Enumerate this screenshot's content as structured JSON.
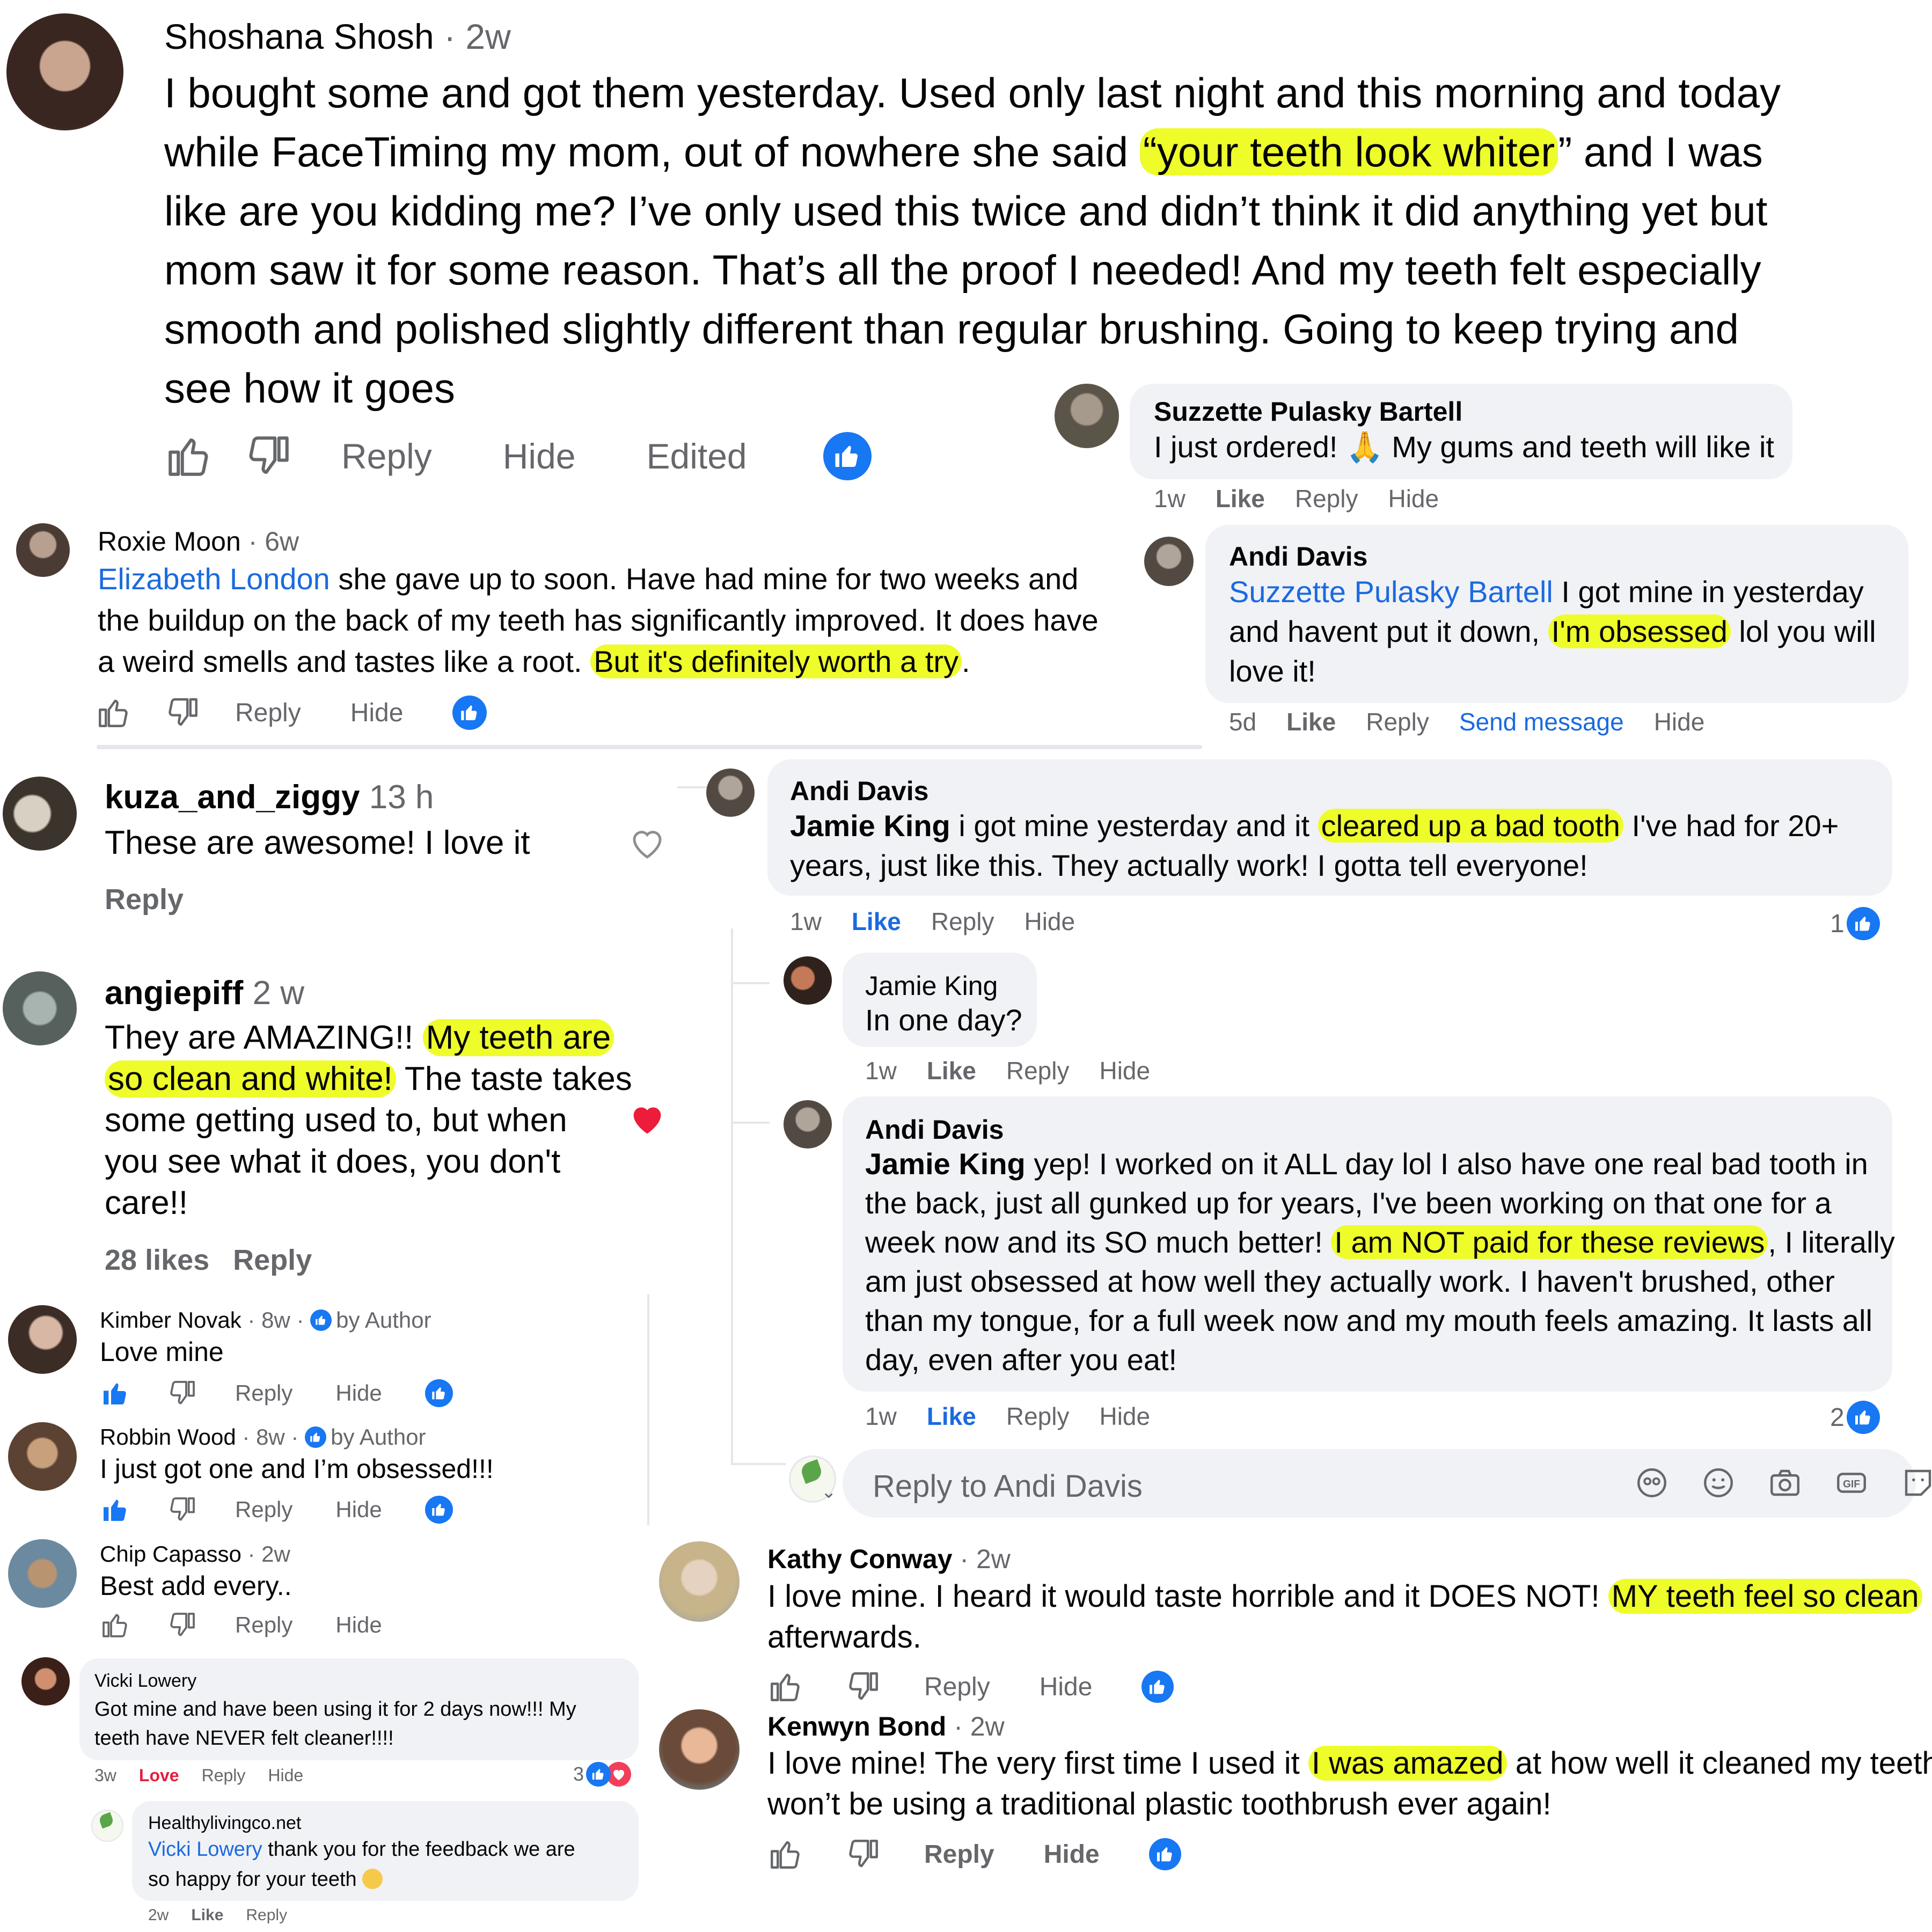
{
  "c1": {
    "author": "Shoshana Shosh",
    "time": "2w",
    "t1": "I bought some and got them yesterday. Used only last night and this morning and today",
    "t2a": "while FaceTiming my mom, out of nowhere she said ",
    "t2hl": "“your teeth look whiter",
    "t2b": "” and I was",
    "t3": "like are you kidding me? I’ve only used this twice and didn’t think it did anything yet but",
    "t4": "mom saw it for some reason. That’s all the proof I needed! And my teeth felt especially",
    "t5": "smooth and polished slightly different than regular brushing. Going to keep trying and",
    "t6": "see how it goes",
    "reply": "Reply",
    "hide": "Hide",
    "edited": "Edited"
  },
  "c2": {
    "author": "Suzzette Pulasky Bartell",
    "text_a": "I just ordered! ",
    "emoji": "🙏",
    "text_b": " My gums and teeth will like it",
    "time": "1w",
    "like": "Like",
    "reply": "Reply",
    "hide": "Hide"
  },
  "c3": {
    "author": "Roxie Moon",
    "time": "6w",
    "mention": "Elizabeth London",
    "t1": " she gave up to soon. Have had mine for two weeks and",
    "t2": "the buildup on the back of my teeth has significantly improved. It does have",
    "t3a": "a weird smells and tastes like a root. ",
    "t3hl": "But it's definitely worth a try",
    "t3b": ".",
    "reply": "Reply",
    "hide": "Hide"
  },
  "c4": {
    "author": "Andi Davis",
    "mention": "Suzzette Pulasky Bartell",
    "t1": " I got mine in yesterday",
    "t2a": "and havent put it down, ",
    "t2hl": "I'm obsessed",
    "t2b": " lol you will",
    "t3": "love it!",
    "time": "5d",
    "like": "Like",
    "reply": "Reply",
    "send": "Send message",
    "hide": "Hide"
  },
  "c5": {
    "author": "kuza_and_ziggy",
    "time": "13 h",
    "text": "These are awesome! I love it",
    "reply": "Reply"
  },
  "c6": {
    "author": "Andi Davis",
    "mention": "Jamie King",
    "t1a": " i got mine yesterday and it ",
    "t1hl": "cleared up a bad tooth",
    "t1b": " I've had for 20+",
    "t2": "years, just like this. They actually work! I gotta tell everyone!",
    "time": "1w",
    "like": "Like",
    "reply": "Reply",
    "hide": "Hide",
    "count": "1"
  },
  "c7": {
    "author": "angiepiff",
    "time": "2 w",
    "t1a": "They are AMAZING!! ",
    "t1hl": "My teeth are",
    "t2hl": "so clean and white!",
    "t2b": " The taste takes",
    "t3": "some getting used to, but when",
    "t4": "you see what it does, you don't",
    "t5": "care!!",
    "likes": "28 likes",
    "reply": "Reply"
  },
  "c8": {
    "author": "Jamie King",
    "text": "In one day?",
    "time": "1w",
    "like": "Like",
    "reply": "Reply",
    "hide": "Hide"
  },
  "c9": {
    "author": "Andi Davis",
    "mention": "Jamie King",
    "t1": " yep! I worked on it ALL day lol I also have one real bad tooth in",
    "t2": "the back, just all gunked up for years, I've been working on that one for a",
    "t3a": "week now and its SO much better! ",
    "t3hl": "I am NOT paid for these reviews",
    "t3b": ", I literally",
    "t4": "am just obsessed at how well they actually work. I haven't brushed, other",
    "t5": "than my tongue, for a full week now and my mouth feels amazing. It lasts all",
    "t6": "day, even after you eat!",
    "time": "1w",
    "like": "Like",
    "reply": "Reply",
    "hide": "Hide",
    "count": "2"
  },
  "reply_box": {
    "placeholder": "Reply to Andi Davis"
  },
  "c10": {
    "author": "Kimber Novak",
    "time": "8w",
    "badge": "by Author",
    "text": "Love mine",
    "reply": "Reply",
    "hide": "Hide"
  },
  "c11": {
    "author": "Robbin Wood",
    "time": "8w",
    "badge": "by Author",
    "text": "I just got one and I’m obsessed!!!",
    "reply": "Reply",
    "hide": "Hide"
  },
  "c12": {
    "author": "Chip Capasso",
    "time": "2w",
    "text": "Best add every..",
    "reply": "Reply",
    "hide": "Hide"
  },
  "c13": {
    "author": "Kathy Conway",
    "time": "2w",
    "t1a": "I love mine. I heard it would taste horrible and it DOES NOT! ",
    "t1hl": "MY teeth feel so clean",
    "t2": "afterwards.",
    "reply": "Reply",
    "hide": "Hide"
  },
  "c14": {
    "author": "Vicki Lowery",
    "t1": "Got mine and have been using it for 2 days now!!! My",
    "t2": "teeth have NEVER felt cleaner!!!!",
    "time": "3w",
    "love": "Love",
    "reply": "Reply",
    "hide": "Hide",
    "count": "3"
  },
  "c15": {
    "author": "Kenwyn Bond",
    "time": "2w",
    "t1a": "I love mine! The very first time I used it ",
    "t1hl": "I was amazed",
    "t1b": " at how well it cleaned my teeth! I",
    "t2": "won’t be using a traditional plastic toothbrush ever again!",
    "reply": "Reply",
    "hide": "Hide"
  },
  "c16": {
    "author": "Healthylivingco.net",
    "mention": "Vicki Lowery",
    "t1": " thank you for the feedback we are",
    "t2": "so happy for your teeth ",
    "time": "2w",
    "like": "Like",
    "reply": "Reply"
  },
  "colors": {
    "highlight": "#eefc2a",
    "link": "#1b6ae0",
    "like_blue": "#1877f2",
    "love_red": "#e41e3f",
    "bubble": "#f0f2f5"
  }
}
